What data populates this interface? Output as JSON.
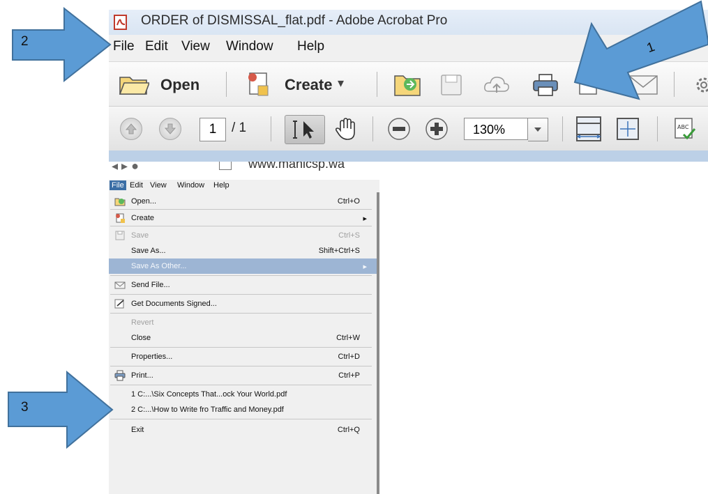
{
  "window": {
    "title": "ORDER of DISMISSAL_flat.pdf - Adobe Acrobat Pro"
  },
  "menubar": {
    "items": [
      "File",
      "Edit",
      "View",
      "Window",
      "Help"
    ]
  },
  "toolbar": {
    "open_label": "Open",
    "create_label": "Create",
    "create_caret": "▾"
  },
  "navbar": {
    "page_number": "1",
    "page_total": "/ 1",
    "zoom": "130%"
  },
  "url_fragment": "www.manicsp.wa",
  "file_menu": {
    "menubar_items": [
      "File",
      "Edit",
      "View",
      "Window",
      "Help"
    ],
    "items": [
      {
        "label": "Open...",
        "shortcut": "Ctrl+O",
        "icon": "open-folder-icon",
        "disabled": false
      },
      {
        "label": "Create",
        "shortcut": "▸",
        "icon": "create-icon",
        "disabled": false
      },
      {
        "label": "Save",
        "shortcut": "Ctrl+S",
        "icon": "save-icon",
        "disabled": true
      },
      {
        "label": "Save As...",
        "shortcut": "Shift+Ctrl+S",
        "icon": "",
        "disabled": false
      },
      {
        "label": "Save As Other...",
        "shortcut": "▸",
        "icon": "",
        "disabled": false,
        "highlighted": true
      },
      {
        "label": "Send File...",
        "shortcut": "",
        "icon": "envelope-icon",
        "disabled": false
      },
      {
        "label": "Get Documents Signed...",
        "shortcut": "",
        "icon": "sign-icon",
        "disabled": false
      },
      {
        "label": "Revert",
        "shortcut": "",
        "icon": "",
        "disabled": true
      },
      {
        "label": "Close",
        "shortcut": "Ctrl+W",
        "icon": "",
        "disabled": false
      },
      {
        "label": "Properties...",
        "shortcut": "Ctrl+D",
        "icon": "",
        "disabled": false
      },
      {
        "label": "Print...",
        "shortcut": "Ctrl+P",
        "icon": "printer-icon",
        "disabled": false
      },
      {
        "label": "1 C:...\\Six Concepts That...ock Your World.pdf",
        "shortcut": "",
        "icon": "",
        "disabled": false
      },
      {
        "label": "2 C:...\\How to Write fro Traffic and Money.pdf",
        "shortcut": "",
        "icon": "",
        "disabled": false
      },
      {
        "label": "Exit",
        "shortcut": "Ctrl+Q",
        "icon": "",
        "disabled": false
      }
    ]
  },
  "callouts": [
    "1",
    "2",
    "3"
  ],
  "colors": {
    "arrow_fill": "#5b9bd5",
    "arrow_stroke": "#41719c",
    "menu_highlight": "#9db5d4",
    "file_highlight": "#3b6ea5"
  }
}
